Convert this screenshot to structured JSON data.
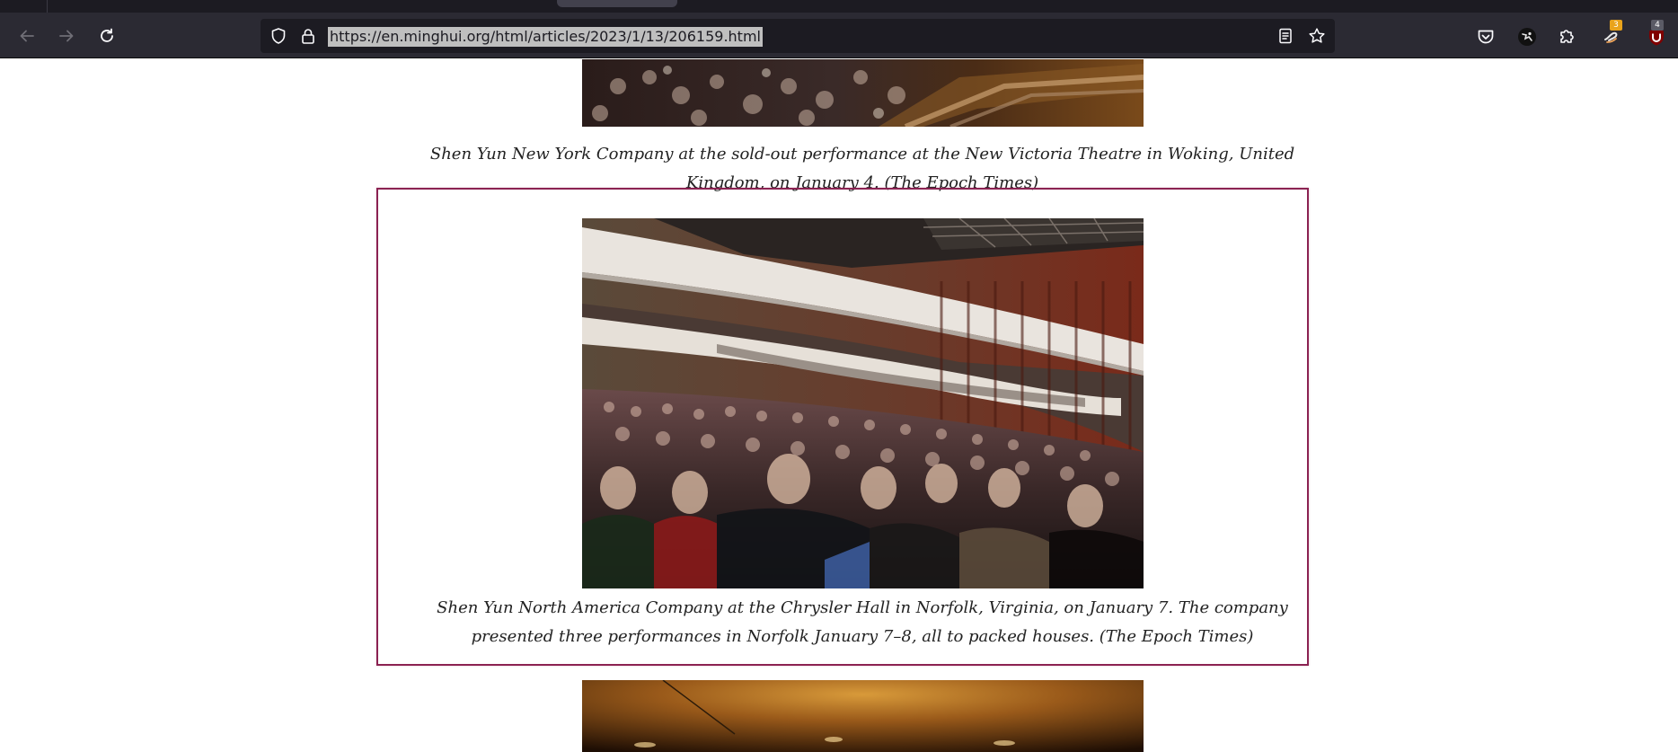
{
  "browser": {
    "url": "https://en.minghui.org/html/articles/2023/1/13/206159.html",
    "nav": {
      "back_icon": "arrow-left-icon",
      "forward_icon": "arrow-right-icon",
      "reload_icon": "reload-icon"
    },
    "urlbar_icons": [
      "shield-icon",
      "lock-icon",
      "reader-view-icon",
      "bookmark-star-icon"
    ],
    "extensions": [
      {
        "name": "pocket-icon",
        "badge": ""
      },
      {
        "name": "extension-avatar-icon",
        "badge": ""
      },
      {
        "name": "extensions-puzzle-icon",
        "badge": ""
      },
      {
        "name": "extension-swirl-icon",
        "badge": "3"
      },
      {
        "name": "ublock-origin-icon",
        "badge": "4"
      }
    ],
    "colors": {
      "toolbar": "#2b2a33",
      "urlbar": "#1c1b22",
      "url_selection": "#bfbfbf",
      "badge_orange": "#e9a31b",
      "badge_dark": "#5b5b66"
    }
  },
  "article": {
    "figures": [
      {
        "caption": "Shen Yun New York Company at the sold-out performance at the New Victoria Theatre in Woking, United Kingdom, on January 4. (The Epoch Times)"
      },
      {
        "caption": "Shen Yun North America Company at the Chrysler Hall in Norfolk, Virginia, on January 7. The company presented three performances in Norfolk January 7–8, all to packed houses. (The Epoch Times)",
        "highlighted": true
      },
      {
        "caption": ""
      }
    ],
    "highlight_color": "#8b2252"
  }
}
